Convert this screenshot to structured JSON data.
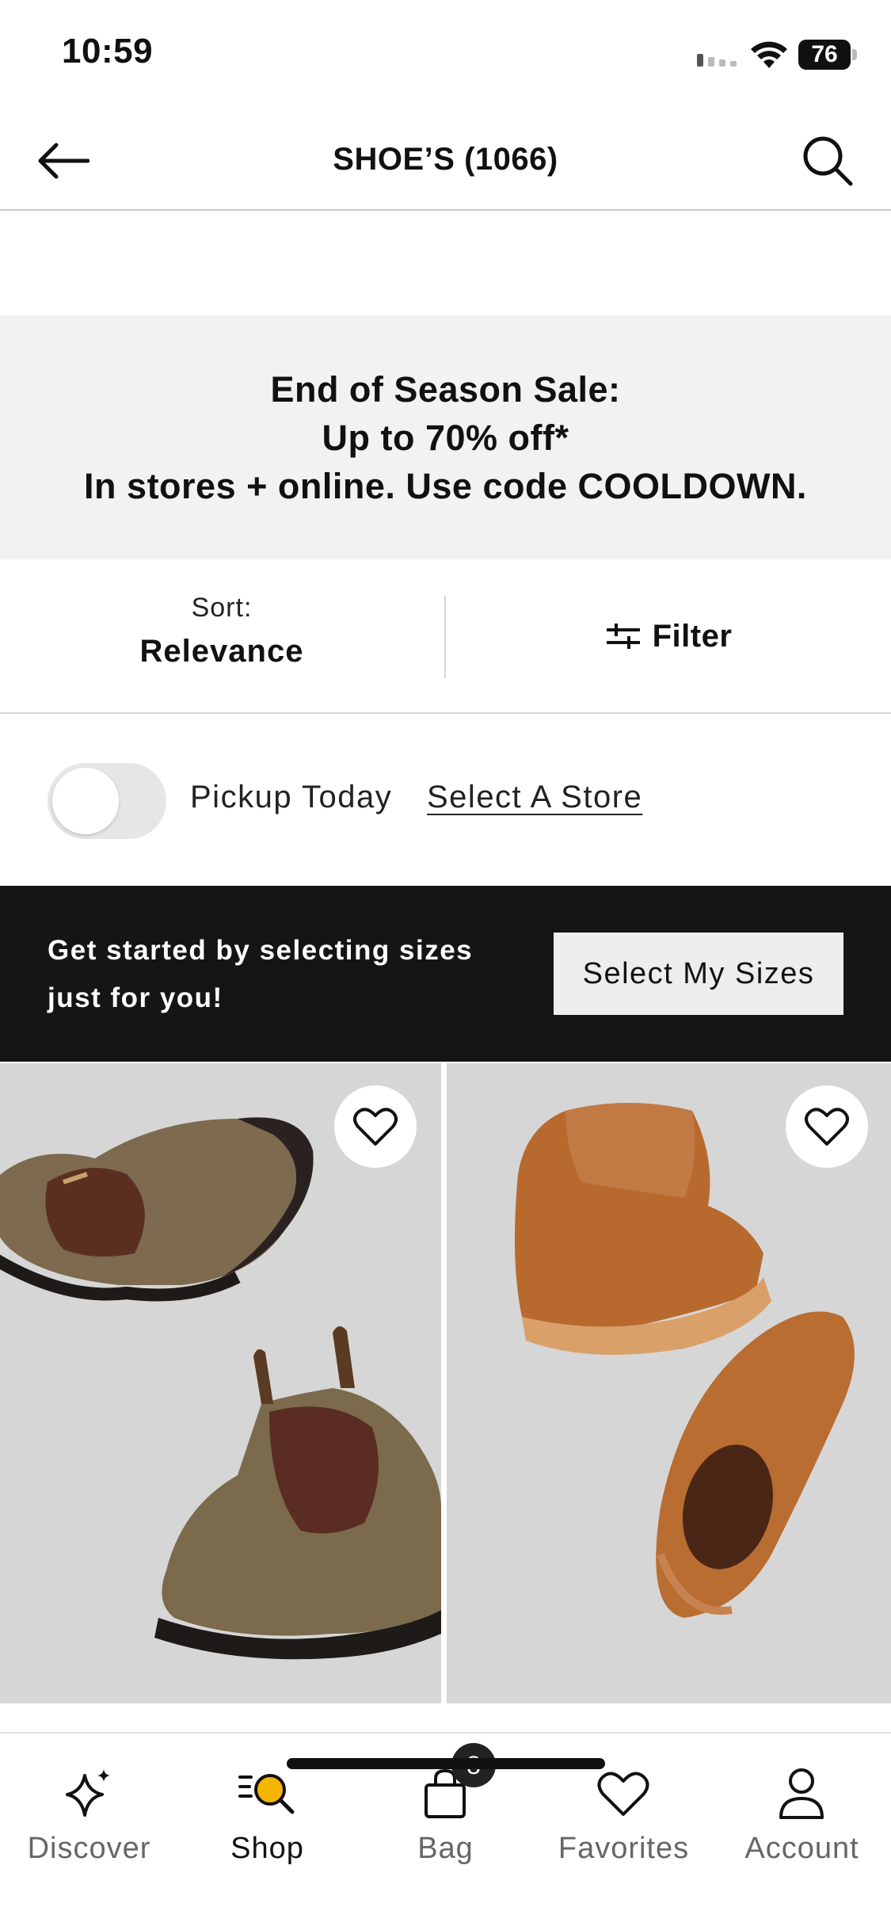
{
  "status_bar": {
    "time": "10:59",
    "battery": "76"
  },
  "header": {
    "title": "SHOE’S (1066)",
    "back_icon": "arrow-left-icon",
    "search_icon": "search-icon"
  },
  "promo": {
    "line1": "End of Season Sale:",
    "line2": "Up to 70% off*",
    "line3": "In stores + online. Use code COOLDOWN."
  },
  "sort": {
    "caption": "Sort:",
    "value": "Relevance"
  },
  "filter": {
    "label": "Filter",
    "icon": "sliders-icon"
  },
  "pickup": {
    "label": "Pickup Today",
    "store_link": "Select A Store",
    "toggle_on": false
  },
  "size_banner": {
    "text": "Get started by selecting sizes just for you!",
    "button": "Select My Sizes"
  },
  "products": [
    {
      "image": "rustic-brown-chelsea-boots",
      "favorited": false
    },
    {
      "image": "tan-leather-chelsea-boots",
      "favorited": false
    }
  ],
  "tabs": [
    {
      "label": "Discover",
      "icon": "sparkle-icon"
    },
    {
      "label": "Shop",
      "icon": "shop-search-icon",
      "active": true
    },
    {
      "label": "Bag",
      "icon": "bag-icon",
      "badge": "8"
    },
    {
      "label": "Favorites",
      "icon": "heart-icon"
    },
    {
      "label": "Account",
      "icon": "person-icon"
    }
  ]
}
